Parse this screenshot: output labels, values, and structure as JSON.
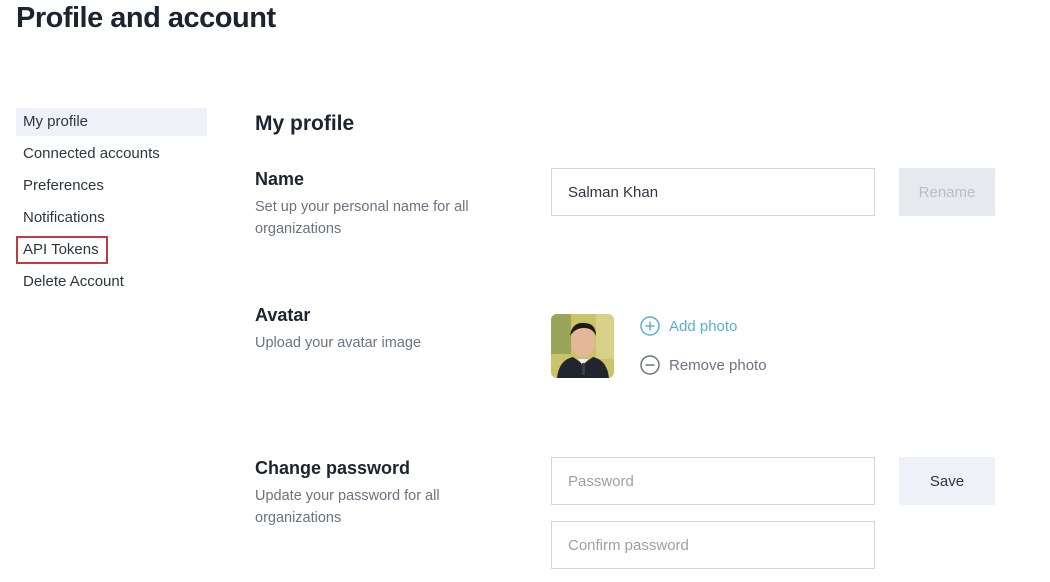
{
  "page": {
    "title": "Profile and account"
  },
  "sidebar": {
    "items": [
      {
        "label": "My profile",
        "active": true
      },
      {
        "label": "Connected accounts"
      },
      {
        "label": "Preferences"
      },
      {
        "label": "Notifications"
      },
      {
        "label": "API Tokens",
        "highlighted": true
      },
      {
        "label": "Delete Account"
      }
    ]
  },
  "main": {
    "title": "My profile",
    "name": {
      "label": "Name",
      "description": "Set up your personal name for all organizations",
      "value": "Salman Khan",
      "button": "Rename"
    },
    "avatar": {
      "label": "Avatar",
      "description": "Upload your avatar image",
      "add_label": "Add photo",
      "remove_label": "Remove photo"
    },
    "password": {
      "label": "Change password",
      "description": "Update your password for all organizations",
      "password_placeholder": "Password",
      "confirm_placeholder": "Confirm password",
      "button": "Save"
    }
  },
  "colors": {
    "accent": "#5aaed9",
    "highlight_border": "#c23b3f",
    "active_bg": "#eef2f8"
  }
}
